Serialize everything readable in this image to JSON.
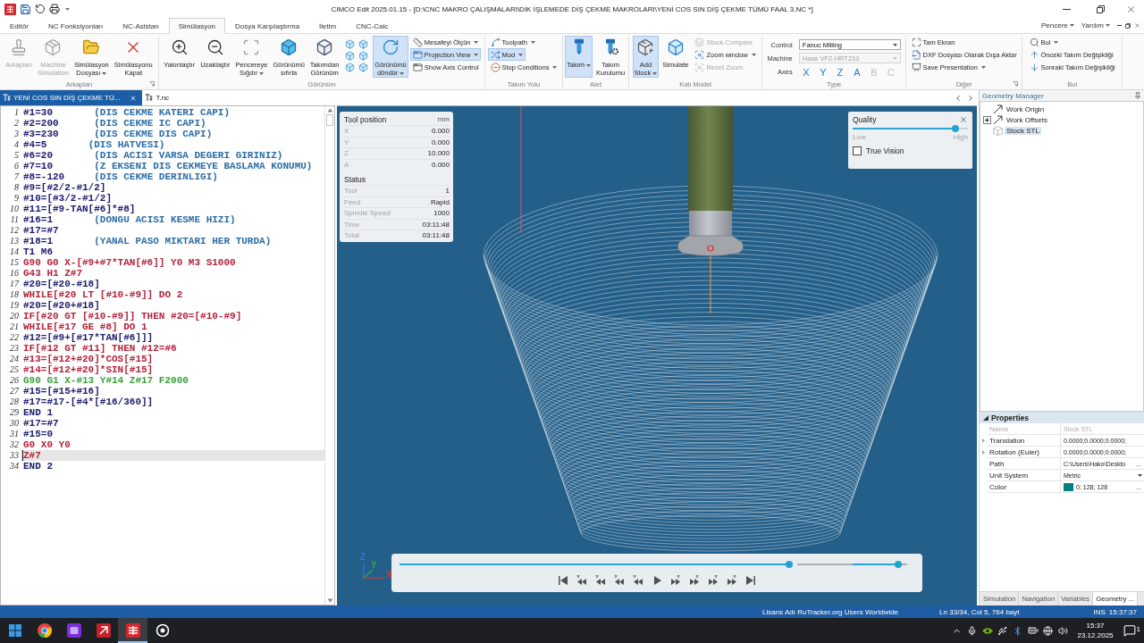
{
  "title_bar": {
    "title": "CIMCO Edit 2025.01.15 - [D:\\CNC MAKRO ÇALIŞMALARI\\DİK İŞLEMEDE DİŞ ÇEKME MAKROLARI\\YENİ COS SIN DİŞ ÇEKME TÜMÜ FAAL 3.NC *]"
  },
  "menu_tabs": [
    {
      "label": "Editör",
      "selected": false
    },
    {
      "label": "NC Fonksiyonları",
      "selected": false
    },
    {
      "label": "NC-Asistan",
      "selected": false
    },
    {
      "label": "Simülasyon",
      "selected": true
    },
    {
      "label": "Dosya Karşılaştırma",
      "selected": false
    },
    {
      "label": "İletim",
      "selected": false
    },
    {
      "label": "CNC-Calc",
      "selected": false
    }
  ],
  "menu_right": [
    {
      "label": "Pencere"
    },
    {
      "label": "Yardım"
    }
  ],
  "ribbon": [
    {
      "label": "Arkaplan",
      "launcher": true,
      "items": [
        {
          "kind": "large",
          "label": "Arkaplan",
          "dropdown": false,
          "selected": false,
          "disabled": true
        },
        {
          "kind": "large",
          "label": "Machine\nSimulation",
          "dropdown": false,
          "selected": false,
          "disabled": true
        },
        {
          "kind": "large",
          "label": "Simülasyon\nDosyası",
          "dropdown": true,
          "selected": false,
          "disabled": false
        },
        {
          "kind": "large",
          "label": "Simülasyonu\nKapat",
          "dropdown": false,
          "selected": false,
          "disabled": false
        }
      ]
    },
    {
      "label": "Görünüm",
      "launcher": false,
      "items": [
        {
          "kind": "large",
          "label": "Yakınlaştır",
          "dropdown": false,
          "selected": false,
          "disabled": false
        },
        {
          "kind": "large",
          "label": "Uzaklaştır",
          "dropdown": false,
          "selected": false,
          "disabled": false
        },
        {
          "kind": "large",
          "label": "Pencereye\nSığdır",
          "dropdown": true,
          "selected": false,
          "disabled": false
        },
        {
          "kind": "large",
          "label": "Görünümü\nsıfırla",
          "dropdown": false,
          "selected": false,
          "disabled": false
        },
        {
          "kind": "large",
          "label": "Takımdan\nGörünüm",
          "dropdown": false,
          "selected": false,
          "disabled": false
        },
        {
          "kind": "icon_grid"
        },
        {
          "kind": "large",
          "label": "Görünümü\ndöndür",
          "dropdown": true,
          "selected": true,
          "disabled": false
        },
        {
          "kind": "stack",
          "items": [
            {
              "label": "Mesafeyi Ölçün",
              "dropdown": true,
              "selected": false,
              "disabled": false
            },
            {
              "label": "Projection View",
              "dropdown": true,
              "selected": true,
              "disabled": false
            },
            {
              "label": "Show Axis Control",
              "dropdown": false,
              "selected": false,
              "disabled": false
            }
          ]
        }
      ]
    },
    {
      "label": "Takım Yolu",
      "launcher": false,
      "items": [
        {
          "kind": "stack",
          "items": [
            {
              "label": "Toolpath",
              "dropdown": true,
              "selected": false,
              "disabled": false
            },
            {
              "label": "Mod",
              "dropdown": true,
              "selected": true,
              "disabled": false
            },
            {
              "label": "Stop Conditions",
              "dropdown": true,
              "selected": false,
              "disabled": false
            }
          ]
        }
      ]
    },
    {
      "label": "Alet",
      "launcher": false,
      "items": [
        {
          "kind": "large",
          "label": "Takım",
          "dropdown": true,
          "selected": true,
          "disabled": false
        },
        {
          "kind": "large",
          "label": "Takım\nKurulumu",
          "dropdown": false,
          "selected": false,
          "disabled": false
        }
      ]
    },
    {
      "label": "Katı Model",
      "launcher": false,
      "items": [
        {
          "kind": "large",
          "label": "Add\nStock",
          "dropdown": true,
          "selected": true,
          "disabled": false
        },
        {
          "kind": "large",
          "label": "Simulate",
          "dropdown": false,
          "selected": false,
          "disabled": false
        },
        {
          "kind": "stack",
          "items": [
            {
              "label": "Stock Compare",
              "dropdown": false,
              "selected": false,
              "disabled": true
            },
            {
              "label": "Zoom window",
              "dropdown": true,
              "selected": false,
              "disabled": false
            },
            {
              "label": "Reset Zoom",
              "dropdown": false,
              "selected": false,
              "disabled": true
            }
          ]
        }
      ]
    },
    {
      "label": "Type",
      "launcher": false,
      "items": [
        {
          "kind": "form",
          "rows": [
            {
              "kind": "select",
              "label": "Control",
              "value": "Fanuc Milling",
              "disabled": false
            },
            {
              "kind": "select",
              "label": "Machine",
              "value": "Haas VF2-HRT210",
              "disabled": true
            },
            {
              "kind": "axes",
              "label": "Axes",
              "axes": [
                {
                  "label": "X",
                  "enabled": true
                },
                {
                  "label": "Y",
                  "enabled": true
                },
                {
                  "label": "Z",
                  "enabled": true
                },
                {
                  "label": "A",
                  "enabled": true
                },
                {
                  "label": "B",
                  "enabled": false
                },
                {
                  "label": "C",
                  "enabled": false
                }
              ]
            }
          ]
        }
      ]
    },
    {
      "label": "Diğer",
      "launcher": true,
      "items": [
        {
          "kind": "stack",
          "items": [
            {
              "label": "Tam Ekran",
              "dropdown": false,
              "selected": false,
              "disabled": false
            },
            {
              "label": "DXF Dosyası Olarak Dışa Aktar",
              "dropdown": false,
              "selected": false,
              "disabled": false
            },
            {
              "label": "Save Presentation",
              "dropdown": true,
              "selected": false,
              "disabled": false
            }
          ]
        }
      ]
    },
    {
      "label": "Bul",
      "launcher": false,
      "items": [
        {
          "kind": "stack",
          "items": [
            {
              "label": "Bul",
              "dropdown": true,
              "selected": false,
              "disabled": false
            },
            {
              "label": "Önceki Takım Değişikliği",
              "dropdown": false,
              "selected": false,
              "disabled": false
            },
            {
              "label": "Sonraki Takım Değişikliği",
              "dropdown": false,
              "selected": false,
              "disabled": false
            }
          ]
        }
      ]
    }
  ],
  "doc_tabs": [
    {
      "label": "YENİ COS SIN DİŞ ÇEKME TÜ...",
      "selected": true,
      "closable": true
    },
    {
      "label": "T.nc",
      "selected": false,
      "closable": false
    }
  ],
  "editor": {
    "lines": [
      {
        "number": "1",
        "text": "#1=30       (DIS CEKME KATERI CAPI)",
        "kind": "plain",
        "current": false
      },
      {
        "number": "2",
        "text": "#2=200      (DIS CEKME IC CAPI)",
        "kind": "plain",
        "current": false
      },
      {
        "number": "3",
        "text": "#3=230      (DIS CEKME DIS CAPI)",
        "kind": "plain",
        "current": false
      },
      {
        "number": "4",
        "text": "#4=5       (DIS HATVESI)",
        "kind": "plain",
        "current": false
      },
      {
        "number": "5",
        "text": "#6=20       (DIS ACISI VARSA DEGERI GIRINIZ)",
        "kind": "plain",
        "current": false
      },
      {
        "number": "6",
        "text": "#7=10       (Z EKSENI DIS CEKMEYE BASLAMA KONUMU)",
        "kind": "plain",
        "current": false
      },
      {
        "number": "7",
        "text": "#8=-120     (DIS CEKME DERINLIGI)",
        "kind": "plain",
        "current": false
      },
      {
        "number": "8",
        "text": "#9=[#2/2-#1/2]",
        "kind": "plain",
        "current": false
      },
      {
        "number": "9",
        "text": "#10=[#3/2-#1/2]",
        "kind": "plain",
        "current": false
      },
      {
        "number": "10",
        "text": "#11=[#9-TAN[#6]*#8]",
        "kind": "plain",
        "current": false
      },
      {
        "number": "11",
        "text": "#16=1       (DONGU ACISI KESME HIZI)",
        "kind": "plain",
        "current": false
      },
      {
        "number": "12",
        "text": "#17=#7",
        "kind": "plain",
        "current": false
      },
      {
        "number": "13",
        "text": "#18=1       (YANAL PASO MIKTARI HER TURDA)",
        "kind": "plain",
        "current": false
      },
      {
        "number": "14",
        "text": "T1 M6",
        "kind": "plain",
        "current": false
      },
      {
        "number": "15",
        "text": "G90 G0 X-[#9+#7*TAN[#6]] Y0 M3 S1000",
        "kind": "command",
        "current": false
      },
      {
        "number": "16",
        "text": "G43 H1 Z#7",
        "kind": "command",
        "current": false
      },
      {
        "number": "17",
        "text": "#20=[#20-#18]",
        "kind": "plain",
        "current": false
      },
      {
        "number": "18",
        "text": "WHILE[#20 LT [#10-#9]] DO 2",
        "kind": "command",
        "current": false
      },
      {
        "number": "19",
        "text": "#20=[#20+#18]",
        "kind": "plain",
        "current": false
      },
      {
        "number": "20",
        "text": "IF[#20 GT [#10-#9]] THEN #20=[#10-#9]",
        "kind": "command",
        "current": false
      },
      {
        "number": "21",
        "text": "WHILE[#17 GE #8] DO 1",
        "kind": "command",
        "current": false
      },
      {
        "number": "22",
        "text": "#12=[#9+[#17*TAN[#6]]]",
        "kind": "plain",
        "current": false
      },
      {
        "number": "23",
        "text": "IF[#12 GT #11] THEN #12=#6",
        "kind": "command",
        "current": false
      },
      {
        "number": "24",
        "text": "#13=[#12+#20]*COS[#15]",
        "kind": "command",
        "current": false
      },
      {
        "number": "25",
        "text": "#14=[#12+#20]*SIN[#15]",
        "kind": "command",
        "current": false
      },
      {
        "number": "26",
        "text": "G90 G1 X-#13 Y#14 Z#17 F2000",
        "kind": "feed",
        "current": false
      },
      {
        "number": "27",
        "text": "#15=[#15+#16]",
        "kind": "plain",
        "current": false
      },
      {
        "number": "28",
        "text": "#17=#17-[#4*[#16/360]]",
        "kind": "plain",
        "current": false
      },
      {
        "number": "29",
        "text": "END 1",
        "kind": "plain",
        "current": false
      },
      {
        "number": "30",
        "text": "#17=#7",
        "kind": "plain",
        "current": false
      },
      {
        "number": "31",
        "text": "#15=0",
        "kind": "plain",
        "current": false
      },
      {
        "number": "32",
        "text": "G0 X0 Y0",
        "kind": "command",
        "current": false
      },
      {
        "number": "33",
        "text": "Z#7",
        "kind": "command",
        "current": true
      },
      {
        "number": "34",
        "text": "END 2",
        "kind": "plain",
        "current": false
      }
    ]
  },
  "viewport": {
    "tool_position": {
      "title": "Tool position",
      "unit": "mm",
      "rows": [
        {
          "label": "X",
          "value": "0.000"
        },
        {
          "label": "Y",
          "value": "0.000"
        },
        {
          "label": "Z",
          "value": "10.000"
        },
        {
          "label": "A",
          "value": "0.000"
        }
      ]
    },
    "status": {
      "title": "Status",
      "rows": [
        {
          "label": "Tool",
          "value": "1"
        },
        {
          "label": "Feed",
          "value": "Rapid"
        },
        {
          "label": "Spindle Speed",
          "value": "1000"
        },
        {
          "label": "Time",
          "value": "03:11:48"
        },
        {
          "label": "Total",
          "value": "03:11:48"
        }
      ]
    },
    "quality": {
      "title": "Quality",
      "level": 0.92,
      "low": "Low",
      "high": "High",
      "true_vision": {
        "label": "True Vision",
        "checked": false
      }
    },
    "axis_labels": [
      {
        "label": "Z",
        "color": "#3a6fe0"
      },
      {
        "label": "Y",
        "color": "#22b34a"
      },
      {
        "label": "X",
        "color": "#e0302a"
      }
    ],
    "playback": {
      "progress": {
        "level": 1
      },
      "speed": {
        "level": 0.95
      }
    }
  },
  "geometry_manager": {
    "title": "Geometry Manager",
    "items": [
      {
        "label": "Work Origin",
        "kind": "arrow",
        "selected": false
      },
      {
        "label": "Work Offsets",
        "kind": "arrow",
        "expanded": false,
        "selected": false
      },
      {
        "label": "Stock STL",
        "kind": "stock",
        "selected": true
      }
    ]
  },
  "properties": {
    "title": "Properties",
    "expanded": true,
    "rows": [
      {
        "name": "Name",
        "value": "Stock STL",
        "kind": "text",
        "disabled": true
      },
      {
        "name": "Translation",
        "value": "0.0000;0.0000;0.0000;",
        "kind": "group",
        "disabled": false
      },
      {
        "name": "Rotation (Euler)",
        "value": "0.0000;0.0000;0.0000;",
        "kind": "group",
        "disabled": false
      },
      {
        "name": "Path",
        "value": "C:\\Users\\Hako\\Deskto",
        "kind": "browse",
        "button": "...",
        "disabled": false
      },
      {
        "name": "Unit System",
        "value": "Metric",
        "kind": "select",
        "disabled": false
      },
      {
        "name": "Color",
        "value": "0; 128; 128",
        "kind": "color",
        "color": "#008080",
        "button": "...",
        "disabled": false
      }
    ]
  },
  "panel_tabs": [
    {
      "label": "Simulation",
      "selected": false
    },
    {
      "label": "Navigation",
      "selected": false
    },
    {
      "label": "Variables",
      "selected": false
    },
    {
      "label": "Geometry ...",
      "selected": true
    }
  ],
  "status_bar": {
    "license": "Lisans Adı RuTracker.org Users Worldwide",
    "position": "Ln 33/34, Col 5, 764 bayt",
    "mode": "INS",
    "clock": "15:37:37"
  },
  "taskbar": {
    "apps": [
      {
        "kind": "start",
        "active": false
      },
      {
        "kind": "browser",
        "active": false
      },
      {
        "kind": "tile",
        "active": false
      },
      {
        "kind": "app",
        "active": false
      },
      {
        "kind": "editor",
        "active": true
      },
      {
        "kind": "ring",
        "active": false
      }
    ],
    "time": "15:37",
    "date": "23.12.2025",
    "notifications": "1"
  }
}
